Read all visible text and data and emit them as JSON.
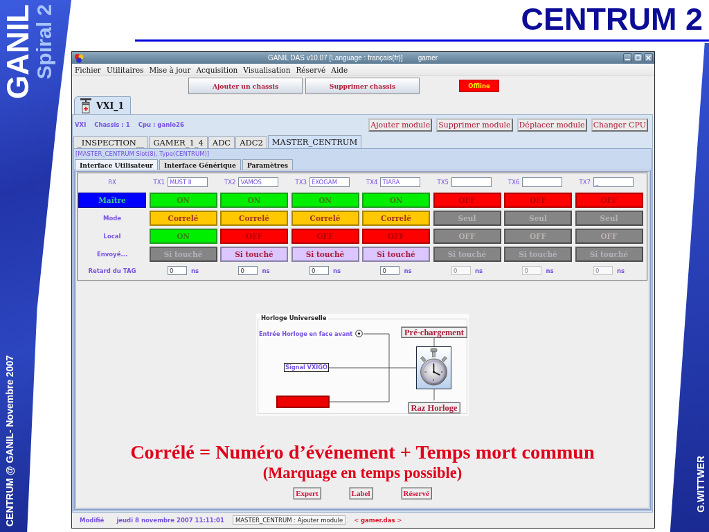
{
  "slide": {
    "logo": "GANIL",
    "logo_subtitle": "Spiral 2",
    "title": "CENTRUM 2",
    "footer_left": "CENTRUM @ GANIL- Novembre 2007",
    "footer_right": "G.WITTWER"
  },
  "window": {
    "title": "GANIL DAS v10.07 [Language : français(fr)]",
    "user": "gamer"
  },
  "menu": [
    "Fichier",
    "Utilitaires",
    "Mise à jour",
    "Acquisition",
    "Visualisation",
    "Réservé",
    "Aide"
  ],
  "toolbar": {
    "buttons": [
      "Ajouter un chassis",
      "Supprimer chassis"
    ],
    "status": {
      "label": "Offline",
      "online": false
    }
  },
  "chassis_tabs": [
    {
      "label": "VXI_1",
      "selected": true
    }
  ],
  "chassis_info": [
    "VXI",
    "Chassis : 1",
    "Cpu : ganlo26"
  ],
  "module_buttons": [
    "Ajouter module",
    "Supprimer module",
    "Déplacer module",
    "Changer CPU"
  ],
  "module_tabs": [
    {
      "label": "_INSPECTION__",
      "selected": false
    },
    {
      "label": "GAMER_1_4",
      "selected": false
    },
    {
      "label": "ADC",
      "selected": false
    },
    {
      "label": "ADC2",
      "selected": false
    },
    {
      "label": "MASTER_CENTRUM",
      "selected": true
    }
  ],
  "module_info": "[MASTER_CENTRUM Slot(8), Type(CENTRUM)]",
  "view_tabs": [
    {
      "label": "Interface Utilisateur",
      "selected": true
    },
    {
      "label": "Interface Générique",
      "selected": false
    },
    {
      "label": "Paramètres",
      "selected": false
    }
  ],
  "routing": {
    "rx_label": "RX",
    "channels": [
      {
        "label": "TX1",
        "name": "MUST II"
      },
      {
        "label": "TX2",
        "name": "VAMOS"
      },
      {
        "label": "TX3",
        "name": "EXOGAM"
      },
      {
        "label": "TX4",
        "name": "TIARA"
      },
      {
        "label": "TX5"
      },
      {
        "label": "TX6"
      },
      {
        "label": "TX7",
        "name": "_"
      }
    ],
    "rows": [
      {
        "label": "Maître",
        "kind": "button",
        "cells": [
          {
            "text": "ON",
            "kind": "on",
            "disabled": false
          },
          {
            "text": "ON",
            "kind": "on",
            "disabled": false
          },
          {
            "text": "ON",
            "kind": "on",
            "disabled": false
          },
          {
            "text": "ON",
            "kind": "on",
            "disabled": false
          },
          {
            "text": "OFF",
            "kind": "off",
            "disabled": false
          },
          {
            "text": "OFF",
            "kind": "off",
            "disabled": false
          },
          {
            "text": "OFF",
            "kind": "off",
            "disabled": false
          }
        ]
      },
      {
        "label": "Mode",
        "kind": "text",
        "cells": [
          {
            "text": "Correlé",
            "kind": "correle",
            "disabled": false
          },
          {
            "text": "Correlé",
            "kind": "correle",
            "disabled": false
          },
          {
            "text": "Correlé",
            "kind": "correle",
            "disabled": false
          },
          {
            "text": "Correlé",
            "kind": "correle",
            "disabled": false
          },
          {
            "text": "Seul",
            "kind": "seul",
            "disabled": true
          },
          {
            "text": "Seul",
            "kind": "seul",
            "disabled": true
          },
          {
            "text": "Seul",
            "kind": "seul",
            "disabled": true
          }
        ]
      },
      {
        "label": "Local",
        "kind": "text",
        "cells": [
          {
            "text": "ON",
            "kind": "on",
            "disabled": false
          },
          {
            "text": "OFF",
            "kind": "off",
            "disabled": false
          },
          {
            "text": "OFF",
            "kind": "off",
            "disabled": false
          },
          {
            "text": "OFF",
            "kind": "off",
            "disabled": false
          },
          {
            "text": "OFF",
            "kind": "off",
            "disabled": true
          },
          {
            "text": "OFF",
            "kind": "off",
            "disabled": true
          },
          {
            "text": "OFF",
            "kind": "off",
            "disabled": true
          }
        ]
      },
      {
        "label": "Envoyé...",
        "kind": "text",
        "cells": [
          {
            "text": "Si touché",
            "kind": "si_touche",
            "disabled": true
          },
          {
            "text": "Si touché",
            "kind": "si_touche",
            "disabled": false
          },
          {
            "text": "Si touché",
            "kind": "si_touche",
            "disabled": false
          },
          {
            "text": "Si touché",
            "kind": "si_touche",
            "disabled": false
          },
          {
            "text": "Si touché",
            "kind": "si_touche",
            "disabled": true
          },
          {
            "text": "Si touché",
            "kind": "si_touche",
            "disabled": true
          },
          {
            "text": "Si touché",
            "kind": "si_touche",
            "disabled": true
          }
        ]
      }
    ],
    "delay": {
      "label": "Retard du TAG",
      "cells": [
        {
          "value": "0",
          "unit": "ns",
          "disabled": false
        },
        {
          "value": "0",
          "unit": "ns",
          "disabled": false
        },
        {
          "value": "0",
          "unit": "ns",
          "disabled": false
        },
        {
          "value": "0",
          "unit": "ns",
          "disabled": false
        },
        {
          "value": "0",
          "unit": "ns",
          "disabled": true
        },
        {
          "value": "0",
          "unit": "ns",
          "disabled": true
        },
        {
          "value": "0",
          "unit": "ns",
          "disabled": true
        }
      ]
    }
  },
  "clock": {
    "title": "Horloge Universelle",
    "front_input": {
      "label": "Entrée Horloge en face avant",
      "checked": true
    },
    "signal": "Signal VXIGO",
    "switch": {
      "on": false
    },
    "preload_button": "Pré-chargement",
    "reset_button": "Raz Horloge"
  },
  "caption": {
    "text": "Corrélé = Numéro d’événement + Temps mort commun",
    "note": "(Marquage en temps possible)"
  },
  "footer_buttons": [
    "Expert",
    "Label",
    "Réservé"
  ],
  "status_bar": {
    "state": "Modifié",
    "date": "jeudi 8 novembre 2007 11:11:01",
    "message": "MASTER_CENTRUM : Ajouter module",
    "file": "< **gamer.das** >"
  }
}
